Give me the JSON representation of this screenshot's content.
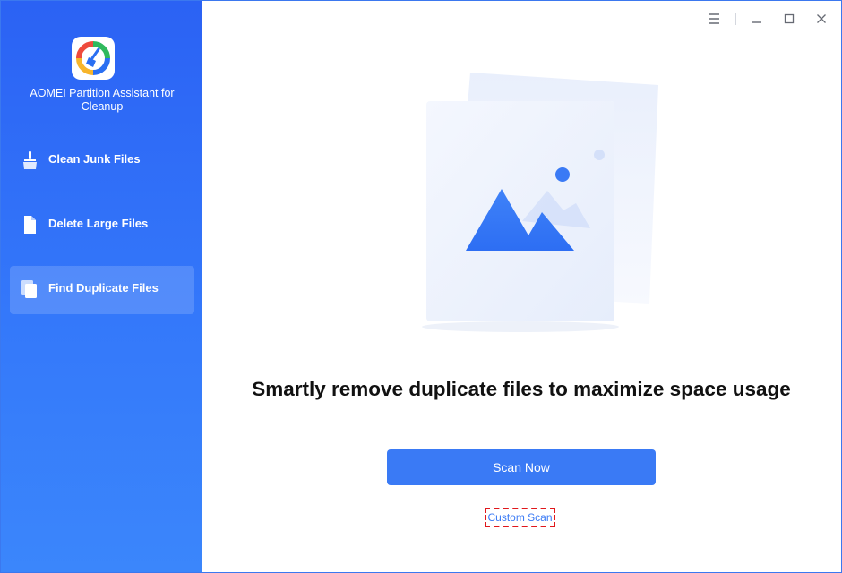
{
  "app": {
    "title": "AOMEI Partition Assistant for Cleanup"
  },
  "sidebar": {
    "items": [
      {
        "label": "Clean Junk Files",
        "icon": "broom-icon",
        "active": false
      },
      {
        "label": "Delete Large Files",
        "icon": "file-icon",
        "active": false
      },
      {
        "label": "Find Duplicate Files",
        "icon": "duplicate-files-icon",
        "active": true
      }
    ]
  },
  "window_controls": [
    "menu-icon",
    "minimize-icon",
    "maximize-icon",
    "close-icon"
  ],
  "main": {
    "headline": "Smartly remove duplicate files to maximize space usage",
    "scan_button": "Scan Now",
    "custom_scan_link": "Custom Scan"
  },
  "colors": {
    "sidebar_top": "#2b62f4",
    "sidebar_bottom": "#3b86fb",
    "accent": "#3a7af5",
    "highlight_border": "#e0171b"
  }
}
